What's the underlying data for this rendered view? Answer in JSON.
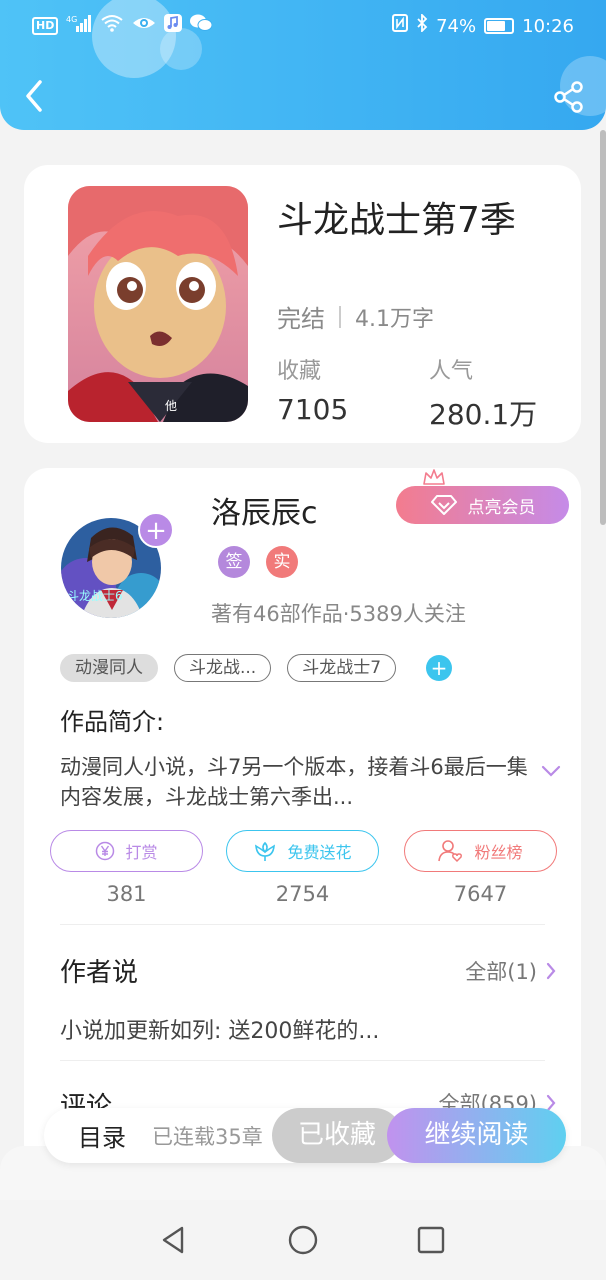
{
  "status_bar": {
    "left_icons": [
      "hd-icon",
      "signal-icon",
      "wifi-icon",
      "eye-icon",
      "music-icon",
      "wechat-icon"
    ],
    "hd_label": "HD",
    "network_label": "4G",
    "battery_percent": "74%",
    "battery_level": 0.74,
    "time": "10:26"
  },
  "header": {
    "back_icon": "chevron-left-icon",
    "share_icon": "share-icon",
    "gradient_start": "#4fc3f7",
    "gradient_end": "#35a8f0"
  },
  "book": {
    "title": "斗龙战士第7季",
    "status": "完结",
    "word_count": "4.1万字",
    "cover_caption": "他",
    "stats": [
      {
        "label": "收藏",
        "value": "7105"
      },
      {
        "label": "人气",
        "value": "280.1万"
      }
    ]
  },
  "author": {
    "name": "洛辰辰c",
    "follow_symbol": "+",
    "vip_button": "点亮会员",
    "badges": [
      "签",
      "实"
    ],
    "stats_text": "著有46部作品·5389人关注",
    "avatar_caption": "斗龙战士6"
  },
  "tags": {
    "items": [
      "动漫同人",
      "斗龙战...",
      "斗龙战士7"
    ],
    "add_symbol": "+"
  },
  "intro": {
    "heading": "作品简介:",
    "text": "动漫同人小说，斗7另一个版本，接着斗6最后一集内容发展，斗龙战士第六季出..."
  },
  "actions": [
    {
      "label": "打赏",
      "count": "381",
      "icon": "yen-coin-icon",
      "color": "#b98ae6"
    },
    {
      "label": "免费送花",
      "count": "2754",
      "icon": "flower-icon",
      "color": "#3cc5ee"
    },
    {
      "label": "粉丝榜",
      "count": "7647",
      "icon": "fan-ranking-icon",
      "color": "#f17a7a"
    }
  ],
  "author_say": {
    "heading": "作者说",
    "link": "全部(1)",
    "text": "小说加更新如列: 送200鲜花的..."
  },
  "comments": {
    "heading": "评论",
    "link": "全部(859)"
  },
  "bottom_bar": {
    "toc": "目录",
    "serial_info": "已连载35章",
    "collected": "已收藏",
    "continue_reading": "继续阅读"
  },
  "nav_bar": {
    "back_icon": "triangle-back-icon",
    "home_icon": "circle-home-icon",
    "recent_icon": "square-recents-icon"
  }
}
